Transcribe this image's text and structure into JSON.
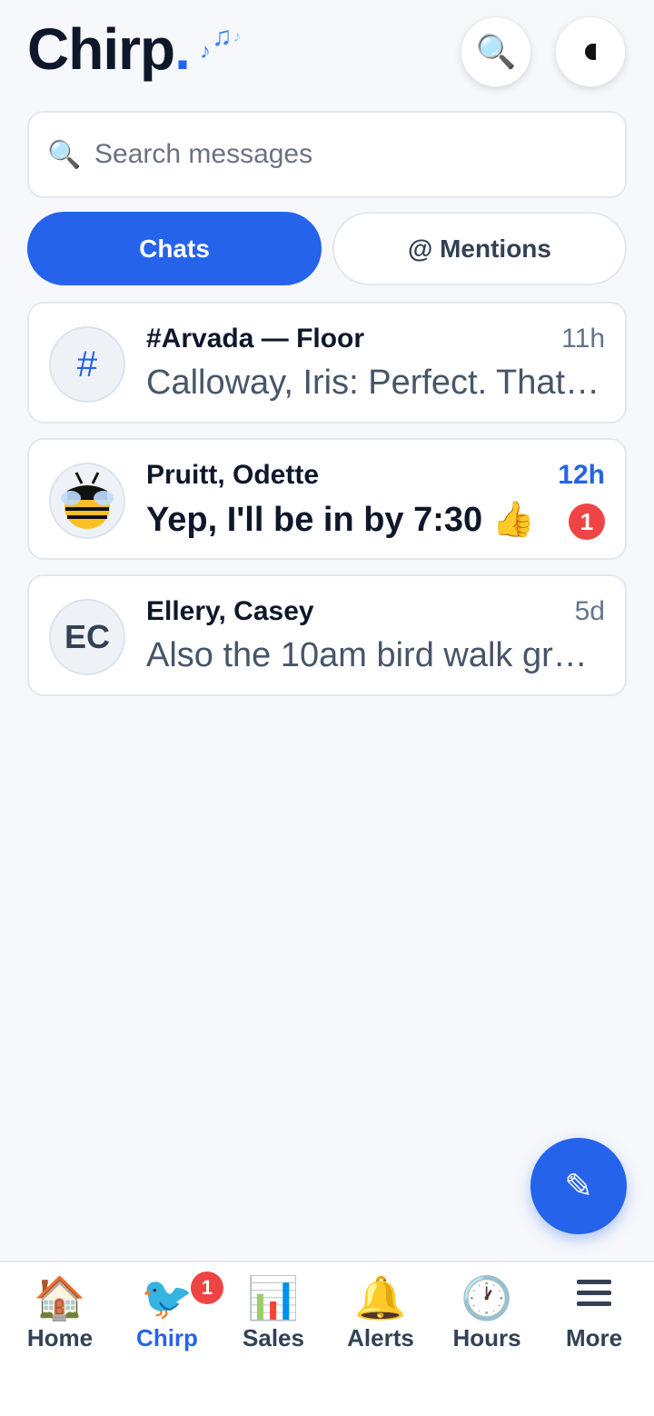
{
  "header": {
    "brand": "Chirp",
    "brand_dot": ".",
    "notes": [
      "♪",
      "♫",
      "♪"
    ],
    "search_icon": "🔍",
    "theme_icon": "moon-icon"
  },
  "search": {
    "icon": "🔍",
    "placeholder": "Search messages"
  },
  "tabs": [
    {
      "label": "Chats",
      "active": true
    },
    {
      "label": "@ Mentions",
      "active": false
    }
  ],
  "conversations": [
    {
      "avatar": "#",
      "name": "#Arvada — Floor",
      "time": "11h",
      "preview": "Calloway, Iris: Perfect. That'…",
      "unread": false
    },
    {
      "avatar": "bee-avatar",
      "name": "Pruitt, Odette",
      "time": "12h",
      "preview": "Yep, I'll be in by 7:30 👍",
      "unread": true,
      "unread_count": "1"
    },
    {
      "avatar": "EC",
      "name": "Ellery, Casey",
      "time": "5d",
      "preview": "Also the 10am bird walk gro…",
      "unread": false
    }
  ],
  "fab": {
    "icon": "✎"
  },
  "nav": [
    {
      "icon": "🏠",
      "label": "Home"
    },
    {
      "icon": "🐦",
      "label": "Chirp",
      "badge": "1",
      "active": true
    },
    {
      "icon": "📊",
      "label": "Sales"
    },
    {
      "icon": "🔔",
      "label": "Alerts"
    },
    {
      "icon": "🕐",
      "label": "Hours"
    },
    {
      "icon": "hamburger-icon",
      "label": "More"
    }
  ],
  "colors": {
    "accent": "#2563eb",
    "badge": "#ef4444",
    "background": "#f7f8fb"
  }
}
